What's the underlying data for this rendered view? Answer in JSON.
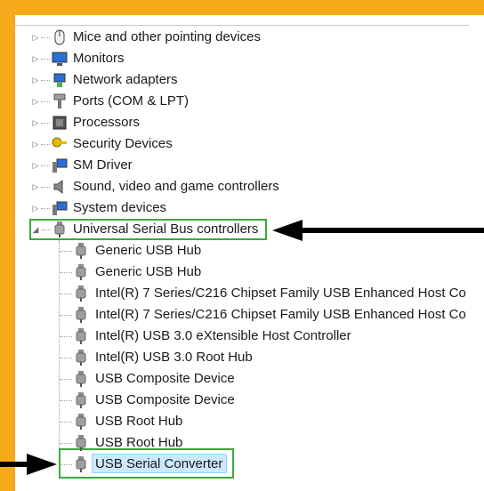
{
  "colors": {
    "frame": "#f7a81b",
    "highlight_box": "#3aab3a",
    "arrow": "#000000",
    "selection": "#cce8ff"
  },
  "tree": {
    "top_items": [
      {
        "label": "Mice and other pointing devices",
        "icon": "mouse-icon"
      },
      {
        "label": "Monitors",
        "icon": "monitor-icon"
      },
      {
        "label": "Network adapters",
        "icon": "network-adapter-icon"
      },
      {
        "label": "Ports (COM & LPT)",
        "icon": "port-icon"
      },
      {
        "label": "Processors",
        "icon": "processor-icon"
      },
      {
        "label": "Security Devices",
        "icon": "security-key-icon"
      },
      {
        "label": "SM Driver",
        "icon": "computer-icon"
      },
      {
        "label": "Sound, video and game controllers",
        "icon": "speaker-icon"
      },
      {
        "label": "System devices",
        "icon": "computer-icon"
      }
    ],
    "expanded_category": {
      "label": "Universal Serial Bus controllers",
      "icon": "usb-plug-icon"
    },
    "usb_children": [
      {
        "label": "Generic USB Hub"
      },
      {
        "label": "Generic USB Hub"
      },
      {
        "label": "Intel(R) 7 Series/C216 Chipset Family USB Enhanced Host Co"
      },
      {
        "label": "Intel(R) 7 Series/C216 Chipset Family USB Enhanced Host Co"
      },
      {
        "label": "Intel(R) USB 3.0 eXtensible Host Controller"
      },
      {
        "label": "Intel(R) USB 3.0 Root Hub"
      },
      {
        "label": "USB Composite Device"
      },
      {
        "label": "USB Composite Device"
      },
      {
        "label": "USB Root Hub"
      },
      {
        "label": "USB Root Hub"
      },
      {
        "label": "USB Serial Converter",
        "selected": true
      }
    ]
  }
}
